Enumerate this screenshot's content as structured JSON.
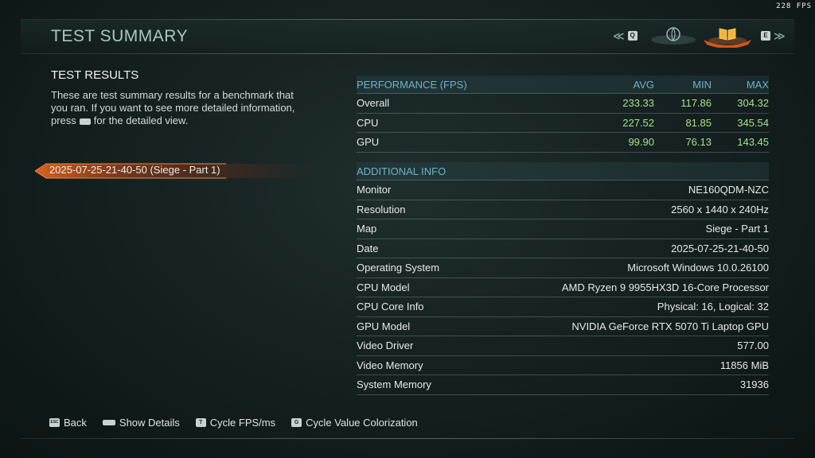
{
  "fps_counter": "228 FPS",
  "header": {
    "title": "TEST SUMMARY",
    "nav_prev_key": "Q",
    "nav_next_key": "E",
    "tabs": [
      {
        "name": "globe-tab",
        "icon": "globe-icon",
        "active": false
      },
      {
        "name": "book-tab",
        "icon": "book-icon",
        "active": true
      }
    ]
  },
  "left": {
    "heading": "TEST RESULTS",
    "desc_part1": "These are test summary results for a benchmark that you ran. If you want to see more detailed information, press",
    "desc_part2": "for the detailed view.",
    "runs": [
      {
        "label": "2025-07-25-21-40-50 (Siege - Part 1)",
        "selected": true
      }
    ]
  },
  "performance": {
    "header": {
      "label": "PERFORMANCE (FPS)",
      "avg": "AVG",
      "min": "MIN",
      "max": "MAX"
    },
    "rows": [
      {
        "label": "Overall",
        "avg": "233.33",
        "min": "117.86",
        "max": "304.32"
      },
      {
        "label": "CPU",
        "avg": "227.52",
        "min": "81.85",
        "max": "345.54"
      },
      {
        "label": "GPU",
        "avg": "99.90",
        "min": "76.13",
        "max": "143.45"
      }
    ]
  },
  "additional": {
    "header": "ADDITIONAL INFO",
    "rows": [
      {
        "label": "Monitor",
        "value": "NE160QDM-NZC"
      },
      {
        "label": "Resolution",
        "value": "2560 x 1440 x 240Hz"
      },
      {
        "label": "Map",
        "value": "Siege - Part 1"
      },
      {
        "label": "Date",
        "value": "2025-07-25-21-40-50"
      },
      {
        "label": "Operating System",
        "value": "Microsoft Windows 10.0.26100"
      },
      {
        "label": "CPU Model",
        "value": "AMD Ryzen 9 9955HX3D 16-Core Processor"
      },
      {
        "label": "CPU Core Info",
        "value": "Physical: 16, Logical: 32"
      },
      {
        "label": "GPU Model",
        "value": "NVIDIA GeForce RTX 5070 Ti Laptop GPU"
      },
      {
        "label": "Video Driver",
        "value": "577.00"
      },
      {
        "label": "Video Memory",
        "value": "11856 MiB"
      },
      {
        "label": "System Memory",
        "value": "31936"
      }
    ]
  },
  "footer": [
    {
      "key": "ESC",
      "label": "Back"
    },
    {
      "key": "",
      "label": "Show Details"
    },
    {
      "key": "T",
      "label": "Cycle FPS/ms"
    },
    {
      "key": "G",
      "label": "Cycle Value Colorization"
    }
  ],
  "colors": {
    "title": "#a9c7c2",
    "section_header": "#6fb3c4",
    "value_green": "#a8e08c",
    "selection_orange": "#e0661f"
  }
}
